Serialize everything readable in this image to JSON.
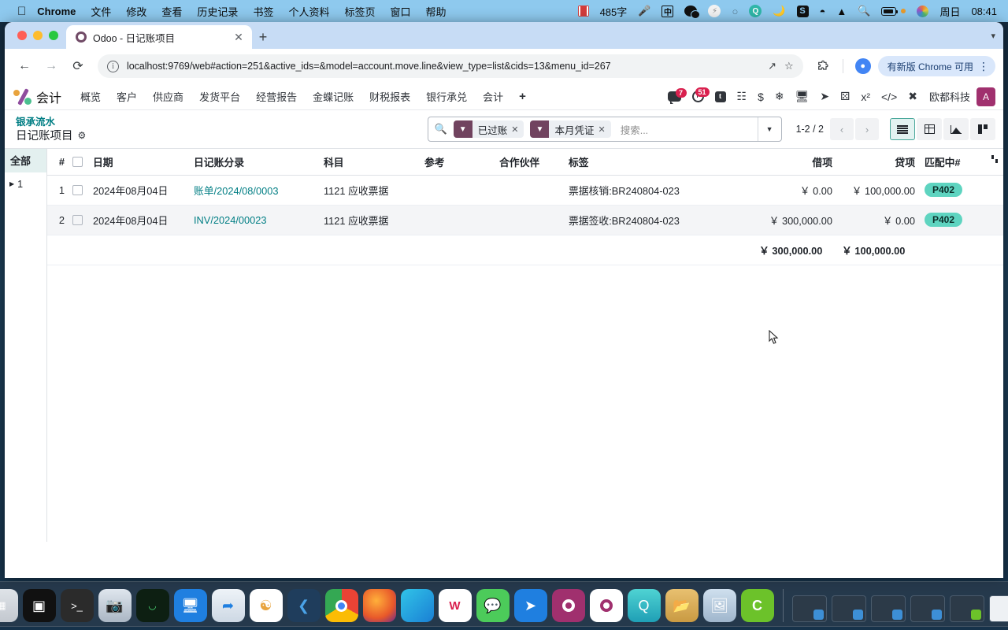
{
  "macbar": {
    "apple": "",
    "items": [
      {
        "label": "Chrome",
        "bold": true
      },
      {
        "label": "文件"
      },
      {
        "label": "修改"
      },
      {
        "label": "查看"
      },
      {
        "label": "历史记录"
      },
      {
        "label": "书签"
      },
      {
        "label": "个人资料"
      },
      {
        "label": "标签页"
      },
      {
        "label": "窗口"
      },
      {
        "label": "帮助"
      }
    ],
    "tray": {
      "word_count": "485字",
      "ime": "中",
      "stardict": "S",
      "day": "周日",
      "time": "08:41"
    }
  },
  "chrome": {
    "tab": {
      "title": "Odoo - 日记账项目",
      "close": "✕"
    },
    "new_tab": "+",
    "tabstrip_chevron": "▾",
    "toolbar": {
      "back": "←",
      "forward": "→",
      "reload": "⟳",
      "url": "localhost:9769/web#action=251&active_ids=&model=account.move.line&view_type=list&cids=13&menu_id=267",
      "share": "↗",
      "bookmark": "☆",
      "extensions": "puzzle-icon",
      "profile": "person-icon",
      "update_label": "有新版 Chrome 可用",
      "menu": "⋮"
    }
  },
  "odoo": {
    "brand": "会计",
    "menus": [
      "概览",
      "客户",
      "供应商",
      "发货平台",
      "经营报告",
      "金蝶记账",
      "财税报表",
      "银行承兑",
      "会计"
    ],
    "menu_plus": "+",
    "systray": {
      "messages_count": "7",
      "activities_count": "51",
      "company": "欧都科技",
      "avatar_initial": "A"
    },
    "breadcrumb": {
      "parent": "银承流水",
      "current": "日记账项目",
      "gear": "⚙"
    },
    "search": {
      "placeholder": "搜索...",
      "facets": [
        {
          "label": "已过账",
          "remove": "✕"
        },
        {
          "label": "本月凭证",
          "remove": "✕"
        }
      ],
      "dropdown": "▼"
    },
    "pager": {
      "count": "1-2 / 2",
      "prev": "‹",
      "next": "›"
    },
    "views": [
      {
        "name": "list",
        "active": true
      },
      {
        "name": "pivot",
        "active": false
      },
      {
        "name": "graph",
        "active": false
      },
      {
        "name": "kanban",
        "active": false
      }
    ],
    "sidebar": {
      "all": "全部",
      "group": "1",
      "caret": "▶"
    },
    "table": {
      "headers": [
        "#",
        "",
        "日期",
        "日记账分录",
        "科目",
        "参考",
        "合作伙伴",
        "标签",
        "借项",
        "贷项",
        "匹配中#"
      ],
      "rows": [
        {
          "idx": "1",
          "date": "2024年08月04日",
          "entry": "账单/2024/08/0003",
          "account": "1121 应收票据",
          "reference": "",
          "partner": "",
          "label": "票据核销:BR240804-023",
          "debit": "￥ 0.00",
          "credit": "￥ 100,000.00",
          "matching": "P402"
        },
        {
          "idx": "2",
          "date": "2024年08月04日",
          "entry": "INV/2024/00023",
          "account": "1121 应收票据",
          "reference": "",
          "partner": "",
          "label": "票据签收:BR240804-023",
          "debit": "￥ 300,000.00",
          "credit": "￥ 0.00",
          "matching": "P402"
        }
      ],
      "totals": {
        "debit": "￥ 300,000.00",
        "credit": "￥ 100,000.00"
      }
    }
  },
  "colors": {
    "accent_teal": "#017e84",
    "facet_purple": "#71435f",
    "chip_green": "#5ed4c0",
    "badge_red": "#d9214f",
    "avatar_magenta": "#a0306e"
  }
}
